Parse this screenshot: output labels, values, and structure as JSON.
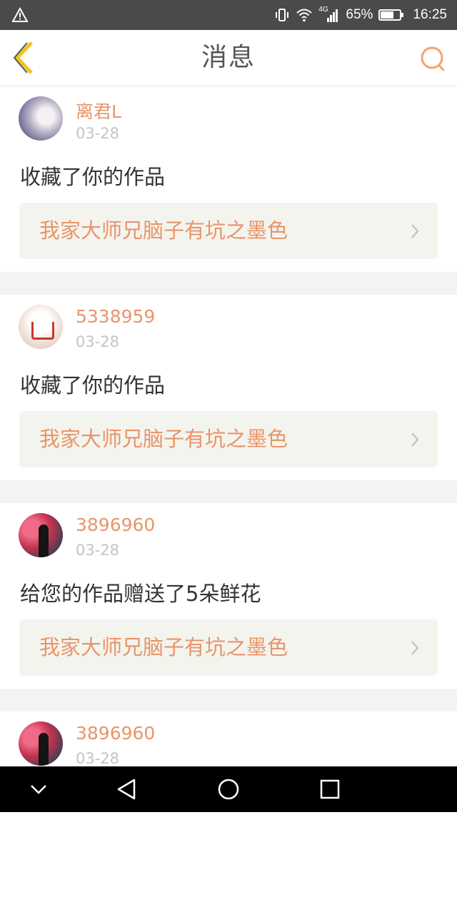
{
  "status_bar": {
    "battery_text": "65%",
    "time": "16:25",
    "network": "4G",
    "icons": [
      "warning-icon",
      "vibrate-icon",
      "wifi-icon",
      "signal-icon",
      "battery-icon"
    ]
  },
  "header": {
    "title": "消息",
    "back_icon": "back-chevron-icon",
    "search_icon": "search-icon"
  },
  "colors": {
    "accent_orange": "#e8956a",
    "back_yellow": "#f0c419",
    "card_bg": "#f4f4ee"
  },
  "messages": [
    {
      "username": "离君L",
      "date": "03-28",
      "action": "收藏了你的作品",
      "work_title": "我家大师兄脑子有坑之墨色"
    },
    {
      "username": "5338959",
      "date": "03-28",
      "action": "收藏了你的作品",
      "work_title": "我家大师兄脑子有坑之墨色"
    },
    {
      "username": "3896960",
      "date": "03-28",
      "action": "给您的作品赠送了5朵鲜花",
      "work_title": "我家大师兄脑子有坑之墨色"
    },
    {
      "username": "3896960",
      "date": "03-28"
    }
  ],
  "nav_bar": {
    "buttons": [
      "chevron-down-icon",
      "back-triangle-icon",
      "home-circle-icon",
      "recents-square-icon"
    ]
  }
}
